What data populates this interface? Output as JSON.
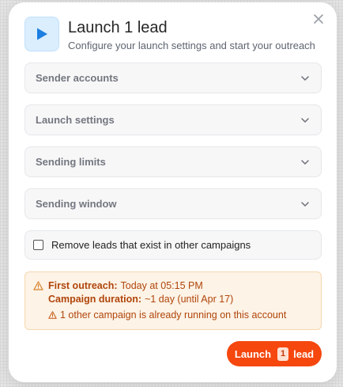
{
  "modal": {
    "title": "Launch 1 lead",
    "subtitle": "Configure your launch settings and start your outreach"
  },
  "icons": {
    "header": "play-icon",
    "close": "close-icon",
    "expand": "chevron-down-icon",
    "warning": "warning-triangle-icon"
  },
  "sections": [
    {
      "label": "Sender accounts"
    },
    {
      "label": "Launch settings"
    },
    {
      "label": "Sending limits"
    },
    {
      "label": "Sending window"
    }
  ],
  "remove_leads": {
    "label": "Remove leads that exist in other campaigns",
    "checked": false
  },
  "summary": {
    "first_outreach_label": "First outreach:",
    "first_outreach_value": "Today at 05:15 PM",
    "duration_label": "Campaign duration:",
    "duration_value": "~1 day (until Apr 17)",
    "warning": "1 other campaign is already running on this account"
  },
  "launch_button": {
    "prefix": "Launch",
    "count": "1",
    "suffix": "lead"
  },
  "colors": {
    "accent": "#f5470e",
    "play_icon": "#1b7ee0",
    "warning_text": "#b0450b",
    "warning_bg": "#fdf3e6"
  }
}
